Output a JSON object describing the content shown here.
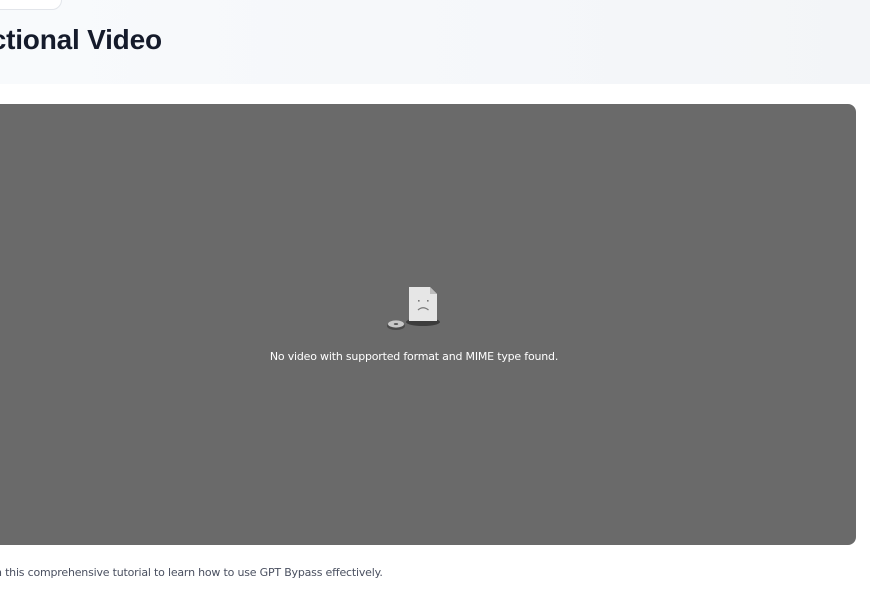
{
  "header": {
    "title": "tructional Video"
  },
  "player": {
    "error_message": "No video with supported format and MIME type found.",
    "error_icon": "broken-file-icon",
    "background_color": "#6a6a6a"
  },
  "description": "h this comprehensive tutorial to learn how to use GPT Bypass effectively."
}
